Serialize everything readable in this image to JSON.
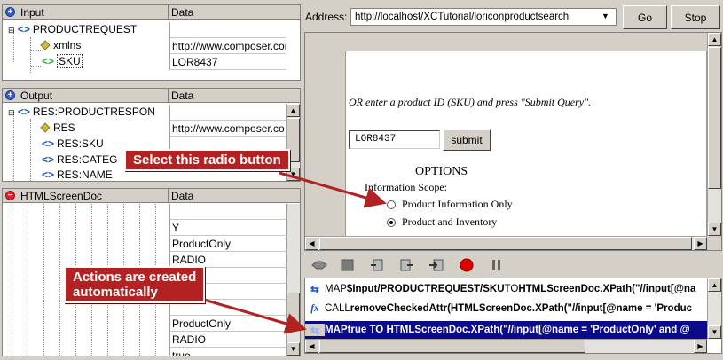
{
  "input_panel": {
    "title": "Input",
    "col_data": "Data",
    "rows": [
      {
        "name": "PRODUCTREQUEST",
        "value": ""
      },
      {
        "name": "xmlns",
        "value": "http://www.composer.com/"
      },
      {
        "name": "SKU",
        "value": "LOR8437"
      }
    ]
  },
  "output_panel": {
    "title": "Output",
    "col_data": "Data",
    "rows": [
      {
        "name": "RES:PRODUCTRESPON",
        "value": ""
      },
      {
        "name": "RES",
        "value": "http://www.composer.co"
      },
      {
        "name": "RES:SKU",
        "value": ""
      },
      {
        "name": "RES:CATEG",
        "value": ""
      },
      {
        "name": "RES:NAME",
        "value": ""
      }
    ]
  },
  "screen_panel": {
    "title": "HTMLScreenDoc",
    "col_data": "Data",
    "values": [
      "Y",
      "ProductOnly",
      "RADIO",
      "",
      "",
      "ProductOnly",
      "RADIO",
      "true"
    ]
  },
  "address": {
    "label": "Address:",
    "url": "http://localhost/XCTutorial/loriconproductsearch",
    "go_label": "Go",
    "stop_label": "Stop"
  },
  "page": {
    "prompt": "OR enter a product ID (SKU) and press \"Submit Query\".",
    "sku_value": "LOR8437",
    "submit_label": "submit",
    "options_title": "OPTIONS",
    "scope_label": "Information Scope:",
    "radio1": "Product Information Only",
    "radio2": "Product and Inventory"
  },
  "actions": [
    {
      "icon": "map-icon",
      "prefix": "MAP ",
      "text": "$Input/PRODUCTREQUEST/SKU",
      "mid": " TO ",
      "rest": "HTMLScreenDoc.XPath(\"//input[@na"
    },
    {
      "icon": "function-icon",
      "prefix": "CALL ",
      "text": "removeCheckedAttr(HTMLScreenDoc.XPath(\"//input[@name = 'Produc",
      "mid": "",
      "rest": ""
    },
    {
      "icon": "map-icon",
      "prefix": "MAP ",
      "text": "true TO HTMLScreenDoc.XPath(\"//input[@name = 'ProductOnly' and @",
      "mid": "",
      "rest": ""
    }
  ],
  "callouts": {
    "radio": "Select this radio button",
    "actions_line1": "Actions are created",
    "actions_line2": "automatically"
  },
  "colors": {
    "callout": "#b22222",
    "selection": "#0a0a8a",
    "tag_blue": "#1a4fbf",
    "tag_green": "#2fa82f"
  }
}
